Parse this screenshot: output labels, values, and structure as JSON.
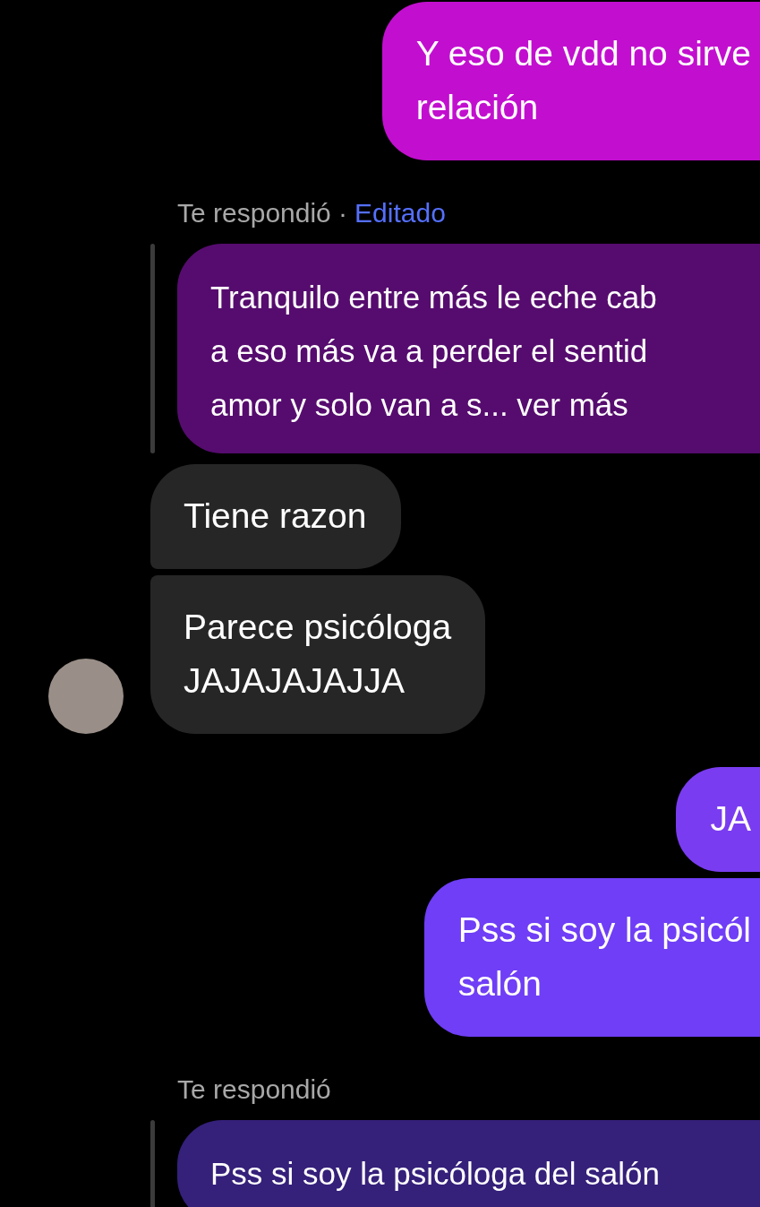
{
  "messages": [
    {
      "kind": "sent",
      "color": "#c20fcf",
      "lines": [
        "Y eso de vdd no sirve",
        "relación"
      ]
    },
    {
      "kind": "reply_label",
      "label": "Te respondió ·",
      "edited": "Editado"
    },
    {
      "kind": "reply_quote",
      "color": "#560c6e",
      "lines": [
        "Tranquilo entre más le eche cab",
        "a eso más va a perder el sentid",
        "amor y solo van a s... ver más"
      ]
    },
    {
      "kind": "received",
      "grouped_above": false,
      "avatar": false,
      "lines": [
        "Tiene razon"
      ]
    },
    {
      "kind": "received",
      "grouped_above": true,
      "avatar": true,
      "lines": [
        "Parece psicóloga",
        "JAJAJAJAJJA"
      ]
    },
    {
      "kind": "sent",
      "color": "#7a3cf0",
      "lines": [
        "JA"
      ]
    },
    {
      "kind": "sent",
      "color": "#6f3ef6",
      "lines": [
        "Pss si soy la psicól",
        "salón"
      ]
    },
    {
      "kind": "reply_label",
      "label": "Te respondió"
    },
    {
      "kind": "reply_quote",
      "color": "#35207a",
      "lines": [
        "Pss si soy la psicóloga del salón"
      ]
    }
  ]
}
